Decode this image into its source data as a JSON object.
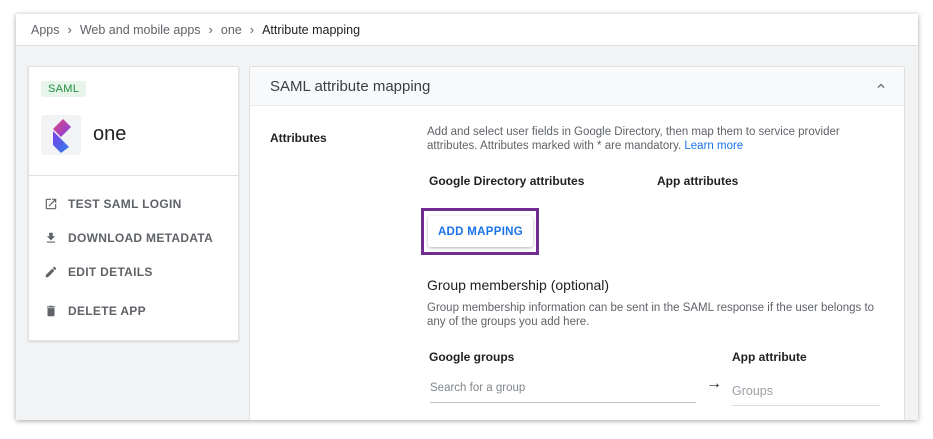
{
  "breadcrumb": {
    "items": [
      "Apps",
      "Web and mobile apps",
      "one"
    ],
    "current": "Attribute mapping",
    "separator": "›"
  },
  "app": {
    "badge": "SAML",
    "name": "one",
    "logo_icon": "app-logo-icon",
    "logo_colors": [
      "#7b3fe4",
      "#e8477f",
      "#2f80ed"
    ]
  },
  "actions": [
    {
      "label": "TEST SAML LOGIN",
      "icon": "open-in-new-icon"
    },
    {
      "label": "DOWNLOAD METADATA",
      "icon": "download-icon"
    },
    {
      "label": "EDIT DETAILS",
      "icon": "pencil-icon"
    },
    {
      "label": "DELETE APP",
      "icon": "trash-icon"
    }
  ],
  "mapping": {
    "title": "SAML attribute mapping",
    "attributes_label": "Attributes",
    "description": "Add and select user fields in Google Directory, then map them to service provider attributes. Attributes marked with * are mandatory.",
    "learn_more": "Learn more",
    "col_directory": "Google Directory attributes",
    "col_app": "App attributes",
    "add_button": "ADD MAPPING"
  },
  "group": {
    "title": "Group membership (optional)",
    "description": "Group membership information can be sent in the SAML response if the user belongs to any of the groups you add here.",
    "col_groups": "Google groups",
    "col_app_attr": "App attribute",
    "search_placeholder": "Search for a group",
    "arrow": "→",
    "groups_placeholder": "Groups"
  },
  "colors": {
    "accent": "#1a73e8",
    "highlight": "#6f2c91",
    "badge_bg": "#e6f4ea",
    "badge_text": "#1e8e3e"
  }
}
